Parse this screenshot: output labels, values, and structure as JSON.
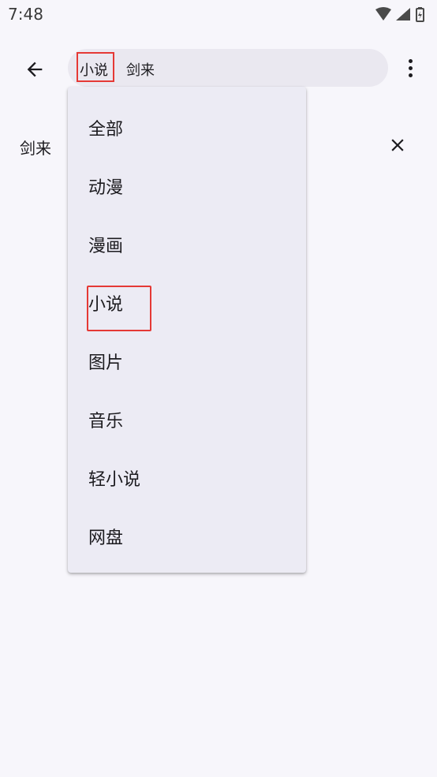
{
  "status_bar": {
    "time": "7:48",
    "icons": [
      "wifi-icon",
      "signal-icon",
      "battery-icon"
    ]
  },
  "toolbar": {
    "back_icon": "arrow-back-icon",
    "category_label": "小说",
    "search_query": "剑来",
    "more_icon": "more-vert-icon"
  },
  "history": {
    "items": [
      {
        "label": "剑来"
      }
    ],
    "clear_icon": "close-icon"
  },
  "dropdown": {
    "items": [
      {
        "label": "全部"
      },
      {
        "label": "动漫"
      },
      {
        "label": "漫画"
      },
      {
        "label": "小说"
      },
      {
        "label": "图片"
      },
      {
        "label": "音乐"
      },
      {
        "label": "轻小说"
      },
      {
        "label": "网盘"
      }
    ],
    "selected": "小说"
  },
  "colors": {
    "highlight": "#e53935",
    "background": "#f7f6fb",
    "menu_background": "#ecebf4",
    "search_background": "#eae8f0"
  }
}
